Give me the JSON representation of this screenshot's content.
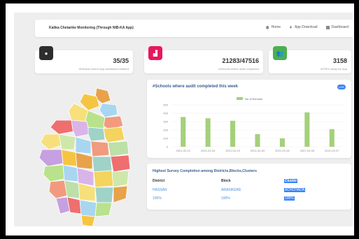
{
  "nav": {
    "brand": "Kalika Chetarike Monitoring (Through NIB-KA App)",
    "links": [
      {
        "label": "Home",
        "icon": "home-icon"
      },
      {
        "label": "App Download",
        "icon": "download-icon"
      },
      {
        "label": "Dashboard",
        "icon": "dashboard-icon"
      }
    ]
  },
  "stats": [
    {
      "value": "35/35",
      "label": "#Districts where App installation initiated",
      "icon": "globe-icon",
      "color": "#2d2d2d"
    },
    {
      "value": "21283/47516",
      "label": "#Schools where audit completed",
      "icon": "school-icon",
      "color": "#e8175d"
    },
    {
      "value": "3158",
      "label": "#CRPs using the App",
      "icon": "users-icon",
      "color": "#4caf50"
    }
  ],
  "chart": {
    "title": "#Schools where audit completed this week",
    "live": "LIVE",
    "legend": "No of Schools"
  },
  "chart_data": {
    "type": "bar",
    "categories": [
      "2021-02-01",
      "2021-02-02",
      "2021-02-03",
      "2021-02-04",
      "2021-02-05",
      "2021-02-06",
      "2021-02-07"
    ],
    "series": [
      {
        "name": "No of Schools",
        "values": [
          355,
          340,
          310,
          150,
          100,
          410,
          210
        ],
        "color": "#a5d07a"
      }
    ],
    "yticks": [
      0,
      100,
      200,
      300,
      400,
      500
    ],
    "ylim": [
      0,
      500
    ]
  },
  "table": {
    "title": "Highest Survey Completion among Districts,Blocks,Clusters",
    "headers": [
      "District",
      "Block",
      "Cluster"
    ],
    "names": [
      "HASSAN",
      "ARASIKERE",
      "ACHCHADA"
    ],
    "percents": [
      "100%",
      "100%",
      "100%"
    ]
  },
  "map": {
    "icon": "karnataka-district-map"
  }
}
